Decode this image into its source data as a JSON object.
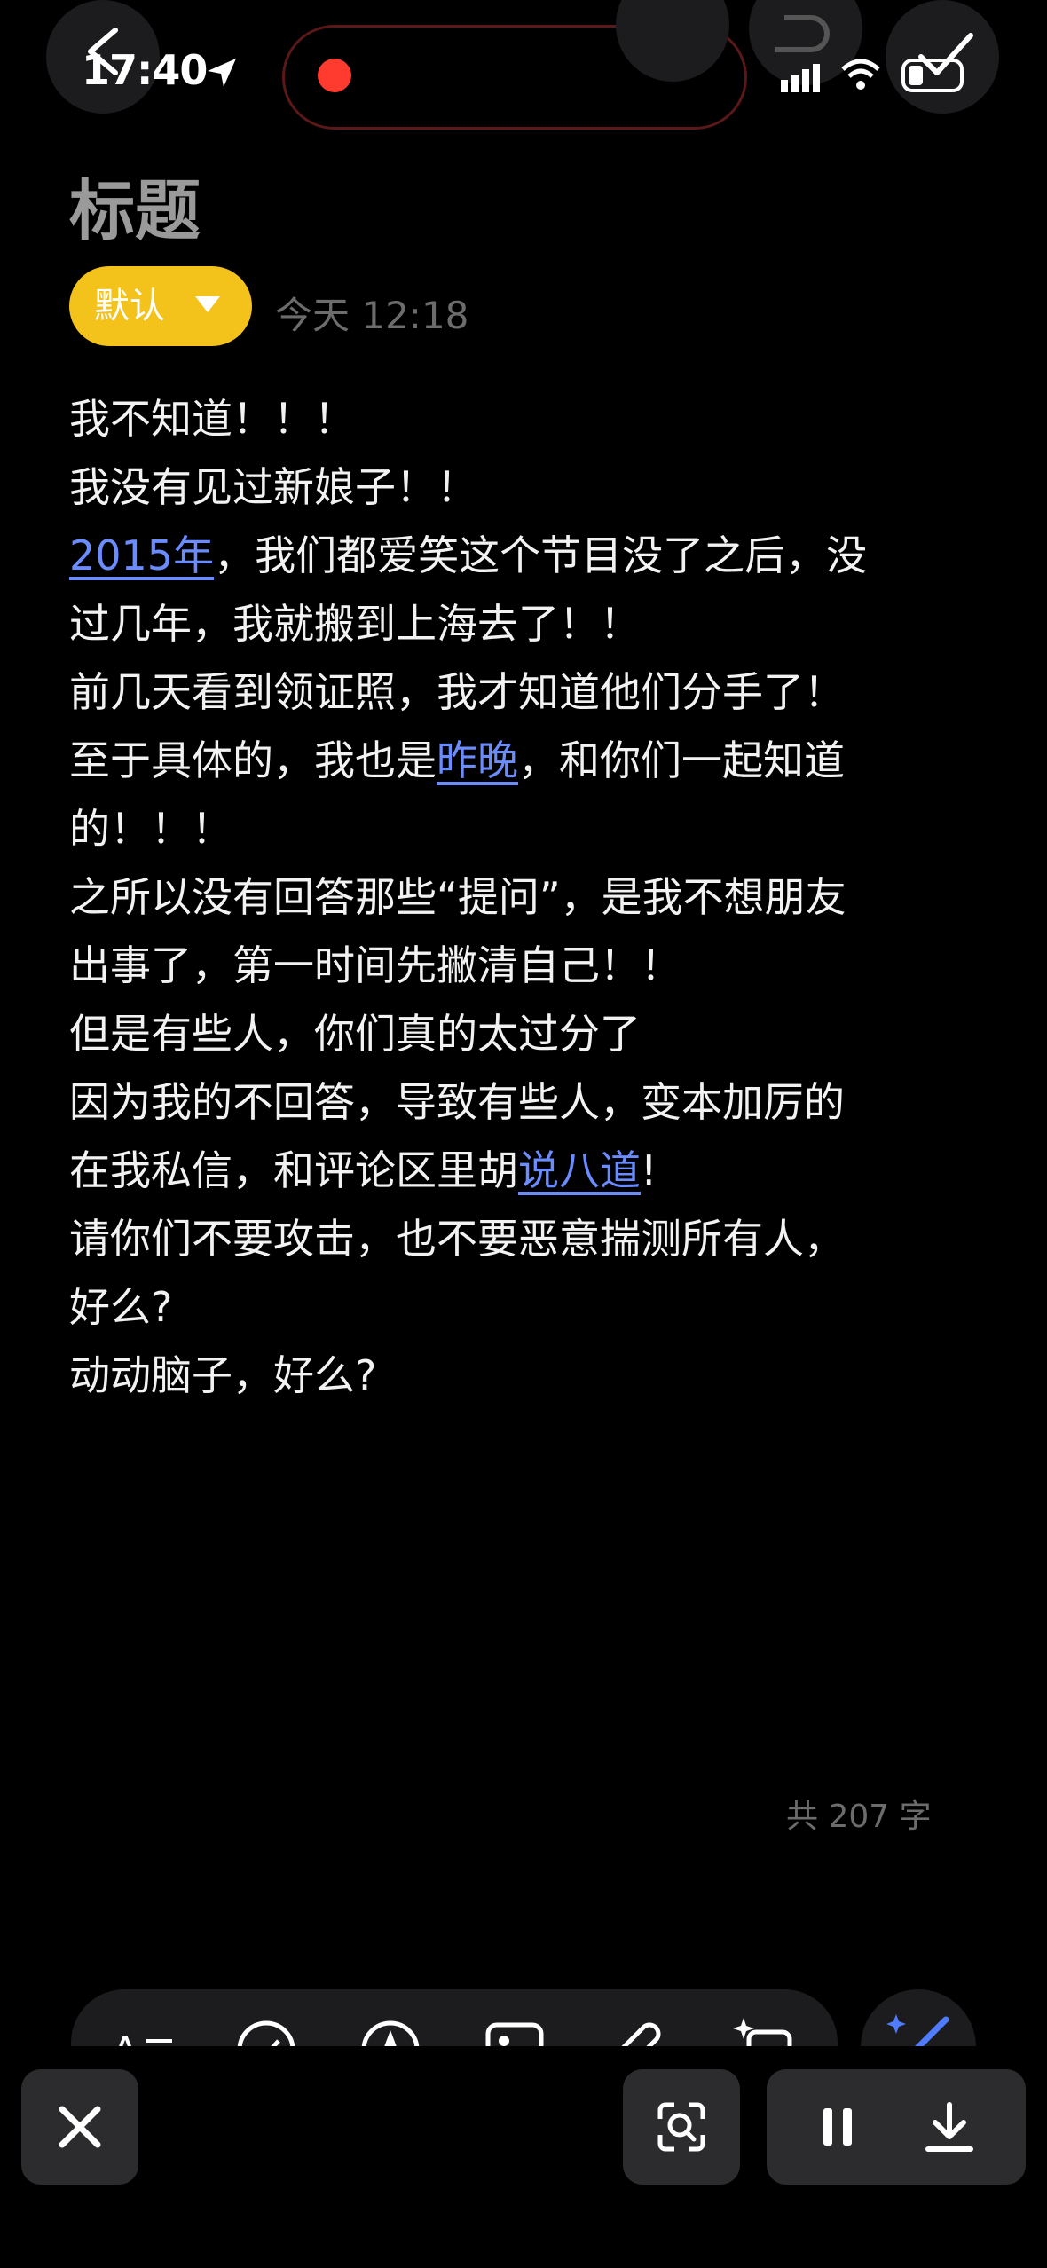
{
  "status_bar": {
    "time": "17:40"
  },
  "note": {
    "title": "标题",
    "category": "默认",
    "date": "今天 12:18",
    "lines": [
      "我不知道！！！",
      "我没有见过新娘子！！",
      {
        "link": "2015年",
        "rest": "，我们都爱笑这个节目没了之后，没"
      },
      "过几年，我就搬到上海去了！！",
      "前几天看到领证照，我才知道他们分手了！",
      {
        "pre": "至于具体的，我也是",
        "link": "昨晚",
        "post": "，和你们一起知道"
      },
      "的！！！",
      "之所以没有回答那些“提问”，是我不想朋友",
      "出事了，第一时间先撇清自己！！",
      "但是有些人，你们真的太过分了",
      "因为我的不回答，导致有些人，变本加厉的",
      {
        "pre": "在我私信，和评论区里胡",
        "link": "说八道",
        "post": "!"
      },
      "请你们不要攻击，也不要恶意揣测所有人，",
      "好么?",
      "动动脑子，好么?"
    ],
    "word_count": "共 207 字"
  },
  "colors": {
    "accent_link": "#6a8cff",
    "category_bg": "#f3c21b",
    "record": "#ff3b30"
  },
  "icons": [
    "back-icon",
    "location-arrow-icon",
    "signal-icon",
    "wifi-icon",
    "battery-icon",
    "check-icon",
    "text-format-icon",
    "checklist-icon",
    "pen-icon",
    "image-icon",
    "attachment-icon",
    "ai-sparkle-icon",
    "magic-wand-icon",
    "close-icon",
    "scan-icon",
    "pause-icon",
    "download-icon"
  ]
}
